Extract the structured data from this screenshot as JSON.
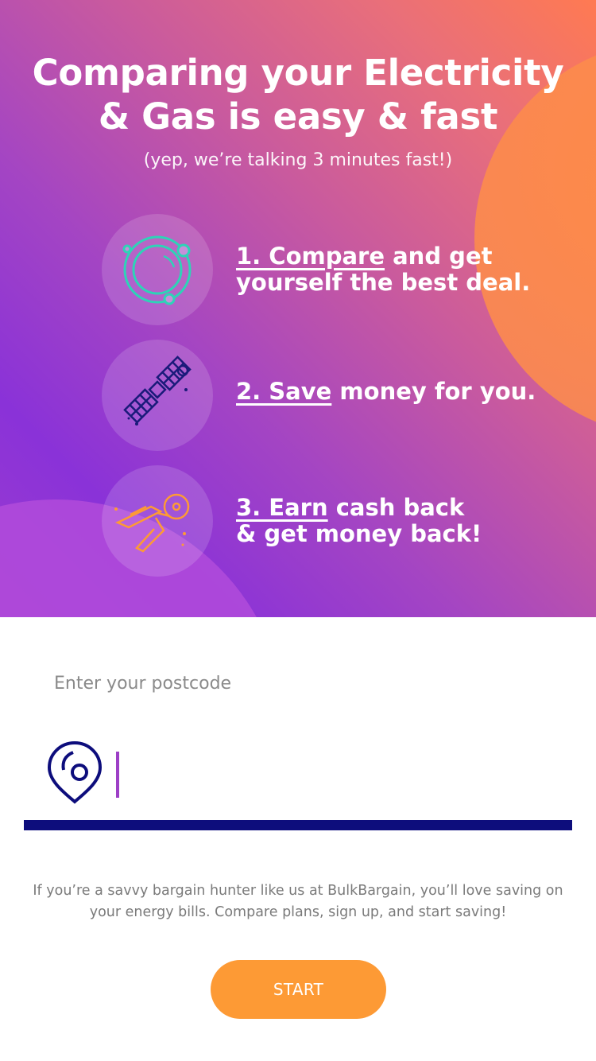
{
  "hero": {
    "title_line1": "Comparing your Electricity",
    "title_line2": "& Gas is easy & fast",
    "subtitle": "(yep, we’re talking 3 minutes fast!)",
    "steps": [
      {
        "lead": "1. Compare",
        "rest_line1": " and get",
        "line2": "yourself the best deal.",
        "icon": "planet-icon"
      },
      {
        "lead": "2. Save",
        "rest_line1": " money for you.",
        "line2": "",
        "icon": "satellite-icon"
      },
      {
        "lead": "3. Earn",
        "rest_line1": " cash back",
        "line2": "& get money back!",
        "icon": "spaceship-icon"
      }
    ]
  },
  "form": {
    "label": "Enter your postcode",
    "postcode_value": "",
    "location_icon": "location-pin-icon"
  },
  "blurb": "If you’re a savvy bargain hunter like us at BulkBargain, you’ll love saving on your energy bills. Compare plans, sign up, and start saving!",
  "start_label": "START",
  "colors": {
    "accent_orange": "#fd9a35",
    "navy": "#0d0d7c",
    "purple": "#8a32d8",
    "teal": "#2ed3b7"
  }
}
